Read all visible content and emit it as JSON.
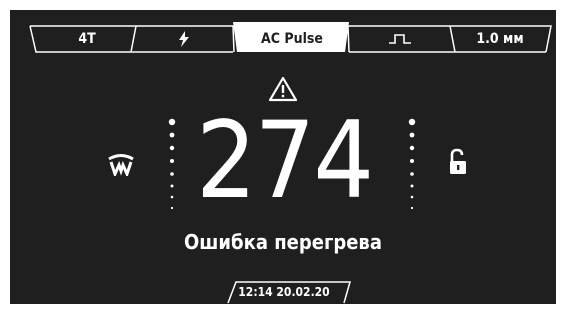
{
  "colors": {
    "background": "#1f1f1f",
    "foreground": "#ffffff",
    "active_tab_fill": "#ffffff",
    "active_tab_text": "#1f1f1f"
  },
  "tabs": [
    {
      "label": "4T",
      "icon": null,
      "active": false
    },
    {
      "label": "",
      "icon": "lightning-icon",
      "active": false
    },
    {
      "label": "AC Pulse",
      "icon": null,
      "active": true
    },
    {
      "label": "",
      "icon": "pulse-wave-icon",
      "active": false
    },
    {
      "label": "1.0 мм",
      "icon": null,
      "active": false
    }
  ],
  "main": {
    "warning_icon": "warning-triangle-icon",
    "left_icon": "tungsten-electrode-icon",
    "right_icon": "unlock-icon",
    "value": "274",
    "message": "Ошибка перегрева",
    "left_level_dots": 8,
    "right_level_dots": 8
  },
  "footer": {
    "datetime": "12:14  20.02.20"
  }
}
